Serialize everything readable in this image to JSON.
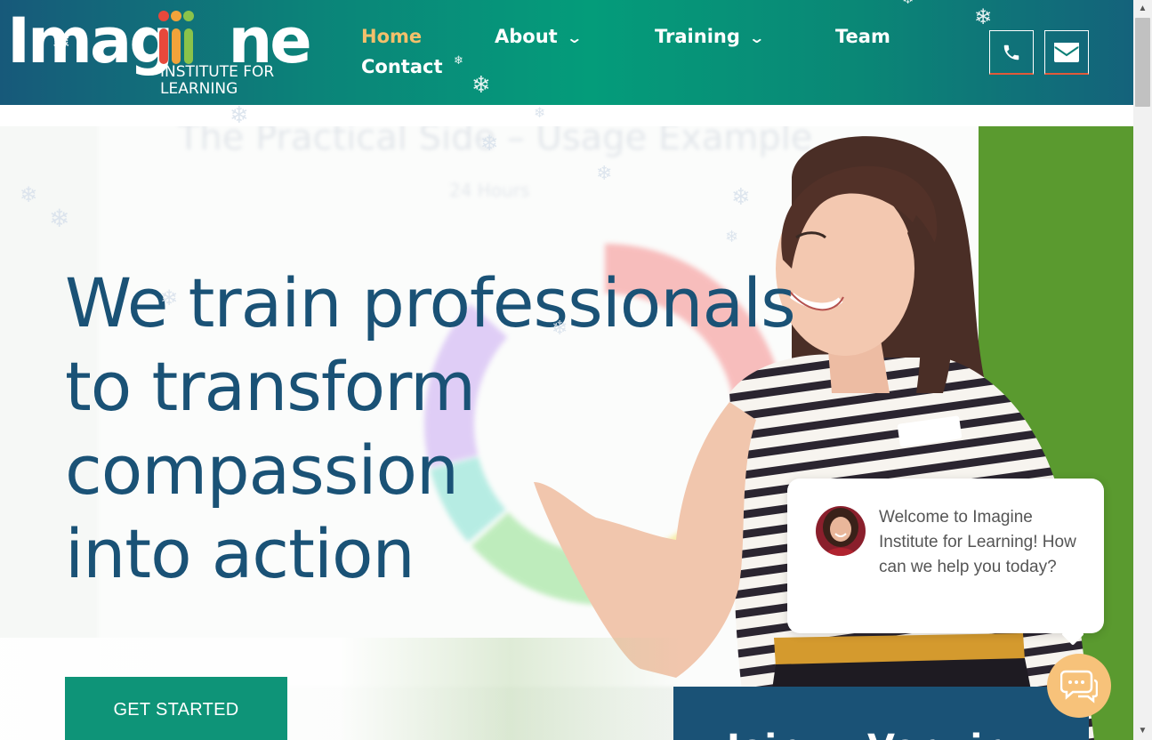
{
  "brand": {
    "logo_word": "Imagine",
    "logo_subtitle": "INSTITUTE FOR LEARNING",
    "ii_colors": [
      "#e8483b",
      "#f2a33a",
      "#8bc34a",
      "#f2a33a"
    ]
  },
  "nav": {
    "items": [
      {
        "label": "Home",
        "active": true
      },
      {
        "label": "About",
        "has_dropdown": true
      },
      {
        "label": "Training",
        "has_dropdown": true
      },
      {
        "label": "Team"
      },
      {
        "label": "Contact"
      }
    ],
    "phone_icon": "phone-icon",
    "email_icon": "envelope-icon"
  },
  "hero": {
    "headline_lines": [
      "We train professionals",
      "to transform",
      "compassion",
      "into action"
    ],
    "cta_label": "GET STARTED",
    "card_partial_text": "Join ...r Ver...ir..."
  },
  "chat": {
    "message": "Welcome to Imagine Institute for Learning! How can we help you today?",
    "launcher_icon": "chat-bubbles-icon"
  },
  "colors": {
    "headline": "#1a5276",
    "cta": "#0e9478",
    "active_nav": "#f3c06b",
    "card": "#1a5276",
    "launcher": "#f7c27a"
  }
}
